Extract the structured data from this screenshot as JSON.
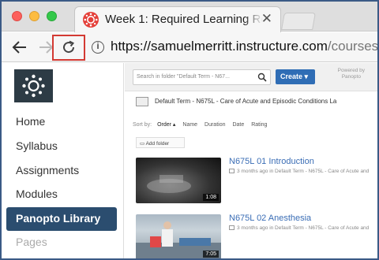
{
  "browser": {
    "tab_title": "Week 1: Required Learning Res",
    "tab_close": "✕",
    "url_host": "https://samuelmerritt.instructure.com",
    "url_path": "/courses/"
  },
  "sidebar": {
    "items": [
      {
        "label": "Home"
      },
      {
        "label": "Syllabus"
      },
      {
        "label": "Assignments"
      },
      {
        "label": "Modules"
      },
      {
        "label": "Panopto Library",
        "active": true
      },
      {
        "label": "Pages"
      }
    ]
  },
  "panopto": {
    "search_placeholder": "Search in folder \"Default Term - N67...",
    "create_label": "Create ▾",
    "powered_line1": "Powered by",
    "powered_line2": "Panopto",
    "folder_name": "Default Term - N675L - Care of Acute and Episodic Conditions La",
    "sort_label": "Sort by:",
    "sort_options": [
      "Order ▴",
      "Name",
      "Duration",
      "Date",
      "Rating"
    ],
    "add_folder": "Add folder",
    "videos": [
      {
        "title": "N675L 01 Introduction",
        "meta": "3 months ago in Default Term - N675L - Care of Acute and",
        "duration": "1:08"
      },
      {
        "title": "N675L 02 Anesthesia",
        "meta": "3 months ago in Default Term - N675L - Care of Acute and",
        "duration": "7:05"
      }
    ]
  },
  "colors": {
    "active_nav": "#2b4d6f",
    "create_button": "#2f6db5",
    "video_link": "#3a6db5",
    "highlight": "#d33a33"
  }
}
